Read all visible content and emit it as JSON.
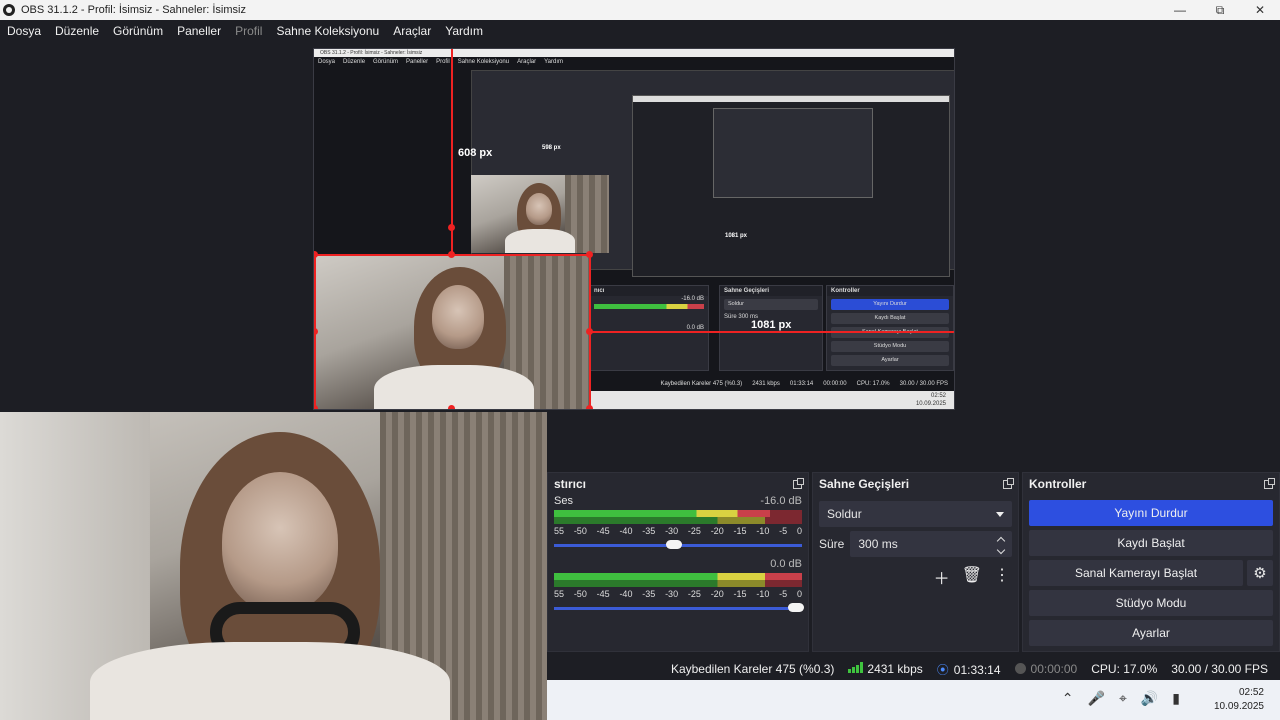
{
  "window": {
    "title": "OBS 31.1.2 - Profil: İsimsiz - Sahneler: İsimsiz"
  },
  "menu": [
    "Dosya",
    "Düzenle",
    "Görünüm",
    "Paneller",
    "Profil",
    "Sahne Koleksiyonu",
    "Araçlar",
    "Yardım"
  ],
  "mini_window": {
    "title": "OBS 31.1.2 - Profil: İsimsiz - Sahneler: İsimsiz",
    "menu": [
      "Dosya",
      "Düzenle",
      "Görünüm",
      "Paneller",
      "Profil",
      "Sahne Koleksiyonu",
      "Araçlar",
      "Yardım"
    ],
    "docks": {
      "mixer": "nıcı",
      "transitions": "Sahne Geçişleri",
      "controls": "Kontroller",
      "transition": "Soldur",
      "duration_label": "Süre",
      "duration": "300 ms"
    },
    "db_top": "-16.0 dB",
    "db_bottom": "0.0 dB",
    "controls": [
      "Yayını Durdur",
      "Kaydı Başlat",
      "Sanal Kamerayı Başlat",
      "Stüdyo Modu",
      "Ayarlar"
    ],
    "status": {
      "dropped": "Kaybedilen Kareler 475 (%0.3)",
      "bitrate": "2431 kbps",
      "time": "01:33:14",
      "rec": "00:00:00",
      "cpu": "CPU: 17.0%",
      "fps": "30.00 / 30.00 FPS"
    },
    "clock_time": "02:52",
    "clock_date": "10.09.2025"
  },
  "guides": {
    "vertical": "608 px",
    "horizontal": "1081 px",
    "nested_small": "598 px",
    "nested_horizontal": "1081 px"
  },
  "mixer": {
    "title": "stırıcı",
    "channel_label": "Ses",
    "db_top": "-16.0 dB",
    "db_bottom": "0.0 dB",
    "ticks": [
      "55",
      "-50",
      "-45",
      "-40",
      "-35",
      "-30",
      "-25",
      "-20",
      "-15",
      "-10",
      "-5",
      "0"
    ],
    "level_top": 0.87,
    "level_bottom": 1.0,
    "volume_top": 0.48,
    "volume_bottom": 1.0
  },
  "transitions": {
    "title": "Sahne Geçişleri",
    "selected": "Soldur",
    "duration_label": "Süre",
    "duration": "300 ms"
  },
  "controls": {
    "title": "Kontroller",
    "stop_stream": "Yayını Durdur",
    "start_recording": "Kaydı Başlat",
    "start_virtual_cam": "Sanal Kamerayı Başlat",
    "studio_mode": "Stüdyo Modu",
    "settings": "Ayarlar"
  },
  "status": {
    "dropped": "Kaybedilen Kareler 475 (%0.3)",
    "bitrate": "2431 kbps",
    "stream_time": "01:33:14",
    "rec_time": "00:00:00",
    "cpu": "CPU: 17.0%",
    "fps": "30.00 / 30.00 FPS"
  },
  "taskbar": {
    "time": "02:52",
    "date": "10.09.2025"
  },
  "colors": {
    "accent": "#2d4fe0",
    "selection": "#e22222",
    "panel": "#272830",
    "background": "#1d1e24"
  }
}
